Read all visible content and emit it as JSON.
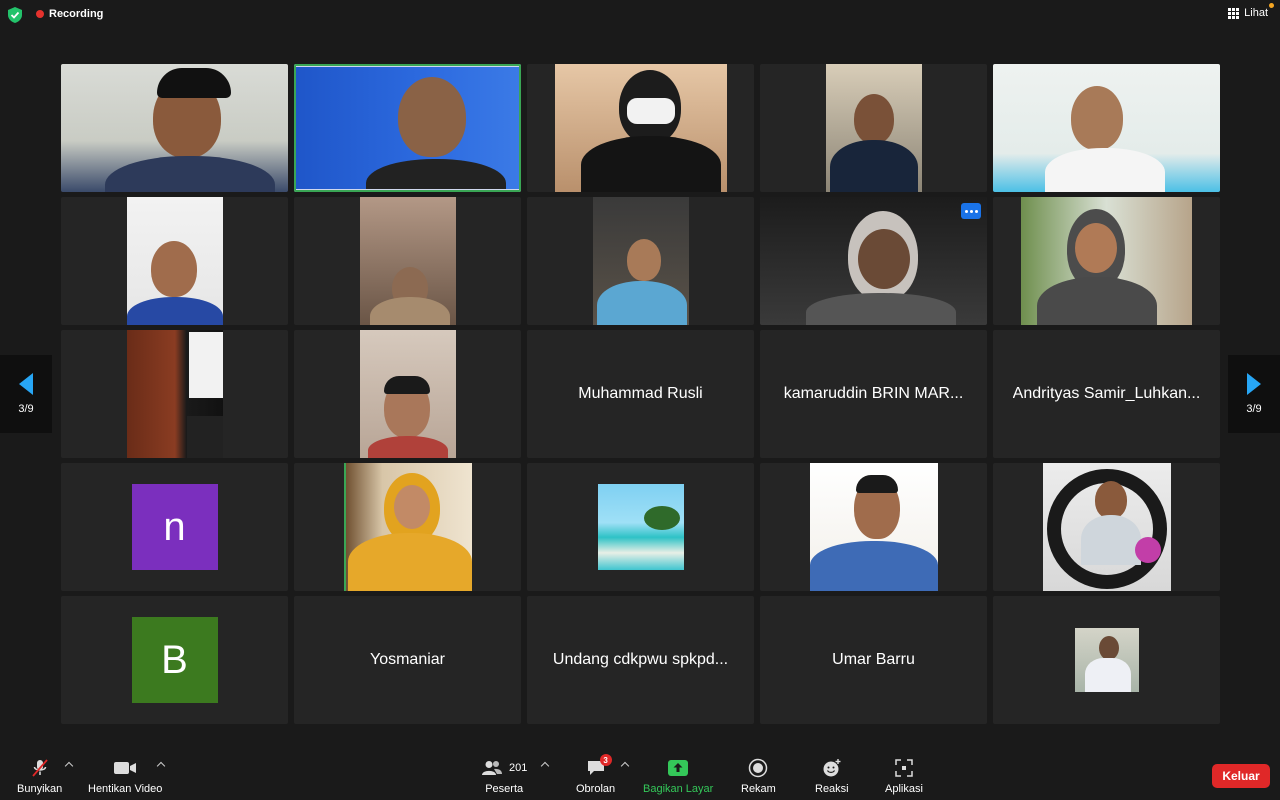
{
  "topbar": {
    "recording_label": "Recording",
    "view_label": "Lihat"
  },
  "pager": {
    "left_count": "3/9",
    "right_count": "3/9"
  },
  "tiles": {
    "name_muhammad_rusli": "Muhammad Rusli",
    "name_kamaruddin": "kamaruddin BRIN  MAR...",
    "name_andrityas": "Andrityas Samir_Luhkan...",
    "avatar_n": "n",
    "avatar_b": "B",
    "name_yosmaniar": "Yosmaniar",
    "name_undang": "Undang cdkpwu spkpd...",
    "name_umar_barru": "Umar Barru"
  },
  "colors": {
    "accent_blue": "#27a6f5",
    "leave_red": "#e02828",
    "share_green": "#34c759",
    "avatar_n_bg": "#7b2fbe",
    "avatar_b_bg": "#3c7a1f"
  },
  "toolbar": {
    "unmute_label": "Bunyikan",
    "stop_video_label": "Hentikan Video",
    "participants_label": "Peserta",
    "participants_count": "201",
    "chat_label": "Obrolan",
    "chat_badge": "3",
    "share_label": "Bagikan Layar",
    "record_label": "Rekam",
    "reactions_label": "Reaksi",
    "apps_label": "Aplikasi",
    "leave_label": "Keluar"
  }
}
